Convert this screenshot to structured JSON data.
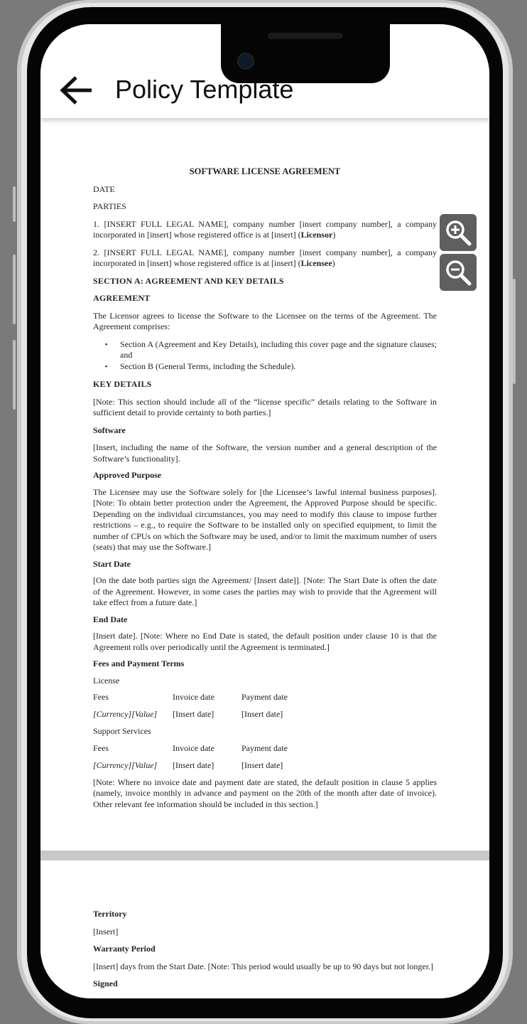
{
  "app": {
    "title": "Policy Template"
  },
  "icons": {
    "back": "arrow-left-icon",
    "zoom_in": "zoom-in-icon",
    "zoom_out": "zoom-out-icon"
  },
  "document": {
    "title": "SOFTWARE LICENSE AGREEMENT",
    "date": "DATE",
    "parties": "PARTIES",
    "party1_a": "1. [INSERT FULL LEGAL NAME], company number [insert company number], a company incorporated in [insert] whose registered office is at [insert] (",
    "party1_role": "Licensor",
    "party2_a": "2. [INSERT FULL LEGAL NAME], company number [insert company number], a company incorporated in [insert] whose registered office is at [insert] (",
    "party2_role": "Licensee",
    "close_paren": ")",
    "section_a": "SECTION A:  AGREEMENT AND KEY DETAILS",
    "agreement_heading": "AGREEMENT",
    "agreement_text": "The Licensor agrees to license the Software to the Licensee on the terms of the Agreement.  The Agreement comprises:",
    "bullets": [
      "Section A (Agreement and Key Details), including this cover page and the signature clauses; and",
      "Section B (General Terms, including the Schedule)."
    ],
    "key_details_heading": "KEY DETAILS",
    "key_details_note": "[Note: This section should include all of the “license specific” details relating to the Software in sufficient detail to provide certainty to both parties.]",
    "software_heading": "Software",
    "software_text": "[Insert, including the name of the Software, the version number and a general description of the Software’s functionality].",
    "approved_heading": "Approved Purpose",
    "approved_text": "The Licensee may use the Software solely for [the Licensee’s lawful internal business purposes]. [Note: To obtain better protection under the Agreement, the Approved Purpose should be specific. Depending on the individual circumstances, you may need to modify this clause to impose further restrictions – e.g., to require the Software to be installed only on specified equipment, to limit the number of CPUs on which the Software may be used, and/or to limit the maximum number of users (seats) that may use the Software.]",
    "start_heading": "Start Date",
    "start_text": "[On the date both parties sign the Agreement/ [Insert date]]. [Note: The Start Date is often the date of the Agreement. However, in some cases the parties may wish to provide that the Agreement will take effect from a future date.]",
    "end_heading": "End Date",
    "end_text": "[Insert date]. [Note: Where no End Date is stated, the default position under clause 10 is that the Agreement rolls over periodically until the Agreement is terminated.]",
    "fees_heading": "Fees and Payment Terms",
    "license_label": "License",
    "support_label": "Support Services",
    "fees_table": {
      "headers": [
        "Fees",
        "Invoice date",
        "Payment date"
      ],
      "row": [
        "[Currency][Value]",
        "[Insert date]",
        "[Insert date]"
      ]
    },
    "fees_note": "[Note: Where no invoice date and payment date are stated, the default position in clause 5 applies (namely, invoice monthly in advance and payment on the 20th of the month after date of invoice).  Other relevant fee information should be included in this section.]",
    "territory_heading": "Territory",
    "territory_text": "[Insert]",
    "warranty_heading": "Warranty Period",
    "warranty_text": "[Insert] days from the Start Date. [Note: This period would usually be up to 90 days but not longer.]",
    "signed_heading": "Signed"
  }
}
